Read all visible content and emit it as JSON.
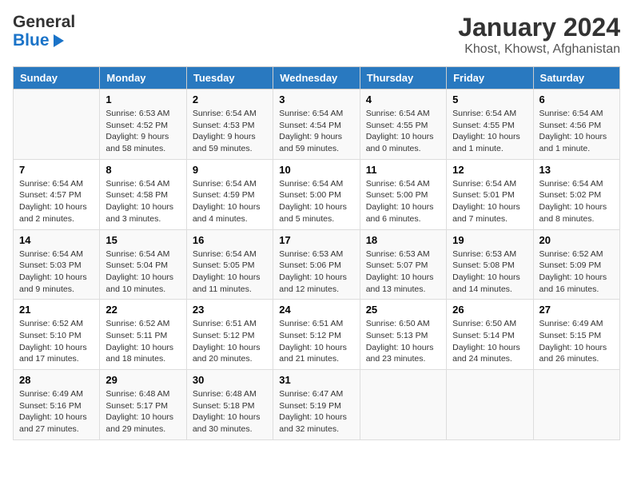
{
  "logo": {
    "line1": "General",
    "line2": "Blue"
  },
  "title": "January 2024",
  "subtitle": "Khost, Khowst, Afghanistan",
  "weekdays": [
    "Sunday",
    "Monday",
    "Tuesday",
    "Wednesday",
    "Thursday",
    "Friday",
    "Saturday"
  ],
  "weeks": [
    [
      {
        "num": "",
        "sunrise": "",
        "sunset": "",
        "daylight": ""
      },
      {
        "num": "1",
        "sunrise": "Sunrise: 6:53 AM",
        "sunset": "Sunset: 4:52 PM",
        "daylight": "Daylight: 9 hours and 58 minutes."
      },
      {
        "num": "2",
        "sunrise": "Sunrise: 6:54 AM",
        "sunset": "Sunset: 4:53 PM",
        "daylight": "Daylight: 9 hours and 59 minutes."
      },
      {
        "num": "3",
        "sunrise": "Sunrise: 6:54 AM",
        "sunset": "Sunset: 4:54 PM",
        "daylight": "Daylight: 9 hours and 59 minutes."
      },
      {
        "num": "4",
        "sunrise": "Sunrise: 6:54 AM",
        "sunset": "Sunset: 4:55 PM",
        "daylight": "Daylight: 10 hours and 0 minutes."
      },
      {
        "num": "5",
        "sunrise": "Sunrise: 6:54 AM",
        "sunset": "Sunset: 4:55 PM",
        "daylight": "Daylight: 10 hours and 1 minute."
      },
      {
        "num": "6",
        "sunrise": "Sunrise: 6:54 AM",
        "sunset": "Sunset: 4:56 PM",
        "daylight": "Daylight: 10 hours and 1 minute."
      }
    ],
    [
      {
        "num": "7",
        "sunrise": "Sunrise: 6:54 AM",
        "sunset": "Sunset: 4:57 PM",
        "daylight": "Daylight: 10 hours and 2 minutes."
      },
      {
        "num": "8",
        "sunrise": "Sunrise: 6:54 AM",
        "sunset": "Sunset: 4:58 PM",
        "daylight": "Daylight: 10 hours and 3 minutes."
      },
      {
        "num": "9",
        "sunrise": "Sunrise: 6:54 AM",
        "sunset": "Sunset: 4:59 PM",
        "daylight": "Daylight: 10 hours and 4 minutes."
      },
      {
        "num": "10",
        "sunrise": "Sunrise: 6:54 AM",
        "sunset": "Sunset: 5:00 PM",
        "daylight": "Daylight: 10 hours and 5 minutes."
      },
      {
        "num": "11",
        "sunrise": "Sunrise: 6:54 AM",
        "sunset": "Sunset: 5:00 PM",
        "daylight": "Daylight: 10 hours and 6 minutes."
      },
      {
        "num": "12",
        "sunrise": "Sunrise: 6:54 AM",
        "sunset": "Sunset: 5:01 PM",
        "daylight": "Daylight: 10 hours and 7 minutes."
      },
      {
        "num": "13",
        "sunrise": "Sunrise: 6:54 AM",
        "sunset": "Sunset: 5:02 PM",
        "daylight": "Daylight: 10 hours and 8 minutes."
      }
    ],
    [
      {
        "num": "14",
        "sunrise": "Sunrise: 6:54 AM",
        "sunset": "Sunset: 5:03 PM",
        "daylight": "Daylight: 10 hours and 9 minutes."
      },
      {
        "num": "15",
        "sunrise": "Sunrise: 6:54 AM",
        "sunset": "Sunset: 5:04 PM",
        "daylight": "Daylight: 10 hours and 10 minutes."
      },
      {
        "num": "16",
        "sunrise": "Sunrise: 6:54 AM",
        "sunset": "Sunset: 5:05 PM",
        "daylight": "Daylight: 10 hours and 11 minutes."
      },
      {
        "num": "17",
        "sunrise": "Sunrise: 6:53 AM",
        "sunset": "Sunset: 5:06 PM",
        "daylight": "Daylight: 10 hours and 12 minutes."
      },
      {
        "num": "18",
        "sunrise": "Sunrise: 6:53 AM",
        "sunset": "Sunset: 5:07 PM",
        "daylight": "Daylight: 10 hours and 13 minutes."
      },
      {
        "num": "19",
        "sunrise": "Sunrise: 6:53 AM",
        "sunset": "Sunset: 5:08 PM",
        "daylight": "Daylight: 10 hours and 14 minutes."
      },
      {
        "num": "20",
        "sunrise": "Sunrise: 6:52 AM",
        "sunset": "Sunset: 5:09 PM",
        "daylight": "Daylight: 10 hours and 16 minutes."
      }
    ],
    [
      {
        "num": "21",
        "sunrise": "Sunrise: 6:52 AM",
        "sunset": "Sunset: 5:10 PM",
        "daylight": "Daylight: 10 hours and 17 minutes."
      },
      {
        "num": "22",
        "sunrise": "Sunrise: 6:52 AM",
        "sunset": "Sunset: 5:11 PM",
        "daylight": "Daylight: 10 hours and 18 minutes."
      },
      {
        "num": "23",
        "sunrise": "Sunrise: 6:51 AM",
        "sunset": "Sunset: 5:12 PM",
        "daylight": "Daylight: 10 hours and 20 minutes."
      },
      {
        "num": "24",
        "sunrise": "Sunrise: 6:51 AM",
        "sunset": "Sunset: 5:12 PM",
        "daylight": "Daylight: 10 hours and 21 minutes."
      },
      {
        "num": "25",
        "sunrise": "Sunrise: 6:50 AM",
        "sunset": "Sunset: 5:13 PM",
        "daylight": "Daylight: 10 hours and 23 minutes."
      },
      {
        "num": "26",
        "sunrise": "Sunrise: 6:50 AM",
        "sunset": "Sunset: 5:14 PM",
        "daylight": "Daylight: 10 hours and 24 minutes."
      },
      {
        "num": "27",
        "sunrise": "Sunrise: 6:49 AM",
        "sunset": "Sunset: 5:15 PM",
        "daylight": "Daylight: 10 hours and 26 minutes."
      }
    ],
    [
      {
        "num": "28",
        "sunrise": "Sunrise: 6:49 AM",
        "sunset": "Sunset: 5:16 PM",
        "daylight": "Daylight: 10 hours and 27 minutes."
      },
      {
        "num": "29",
        "sunrise": "Sunrise: 6:48 AM",
        "sunset": "Sunset: 5:17 PM",
        "daylight": "Daylight: 10 hours and 29 minutes."
      },
      {
        "num": "30",
        "sunrise": "Sunrise: 6:48 AM",
        "sunset": "Sunset: 5:18 PM",
        "daylight": "Daylight: 10 hours and 30 minutes."
      },
      {
        "num": "31",
        "sunrise": "Sunrise: 6:47 AM",
        "sunset": "Sunset: 5:19 PM",
        "daylight": "Daylight: 10 hours and 32 minutes."
      },
      {
        "num": "",
        "sunrise": "",
        "sunset": "",
        "daylight": ""
      },
      {
        "num": "",
        "sunrise": "",
        "sunset": "",
        "daylight": ""
      },
      {
        "num": "",
        "sunrise": "",
        "sunset": "",
        "daylight": ""
      }
    ]
  ]
}
